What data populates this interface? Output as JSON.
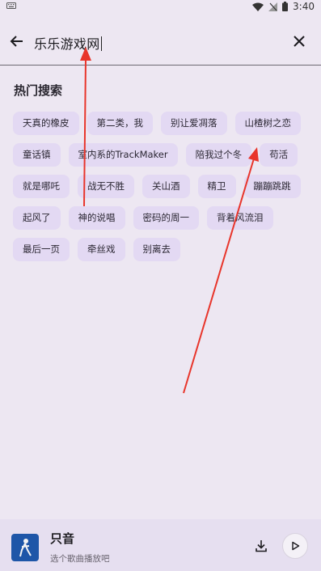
{
  "status_bar": {
    "time": "3:40",
    "icons": [
      "keyboard-icon",
      "wifi-icon",
      "signal-off-icon",
      "battery-icon"
    ]
  },
  "search": {
    "query": "乐乐游戏网",
    "back_icon": "arrow-left-icon",
    "clear_icon": "close-icon"
  },
  "hot_search": {
    "title": "热门搜索",
    "rows": [
      [
        "天真的橡皮",
        "第二类，我",
        "别让爱凋落",
        "山楂树之恋"
      ],
      [
        "童话镇",
        "室内系的TrackMaker",
        "陪我过个冬",
        "苟活"
      ],
      [
        "就是哪吒",
        "战无不胜",
        "关山酒",
        "精卫",
        "蹦蹦跳跳"
      ],
      [
        "起风了",
        "神的说唱",
        "密码的周一",
        "背着风流泪"
      ],
      [
        "最后一页",
        "牵丝戏",
        "别离去"
      ]
    ]
  },
  "player": {
    "title": "只音",
    "subtitle": "选个歌曲播放吧",
    "download_icon": "download-icon",
    "play_icon": "play-icon"
  },
  "colors": {
    "background": "#ede7f2",
    "tag_background": "#e3d9f3",
    "annotation_arrow": "#e8352b",
    "cover": "#1e56a8"
  }
}
